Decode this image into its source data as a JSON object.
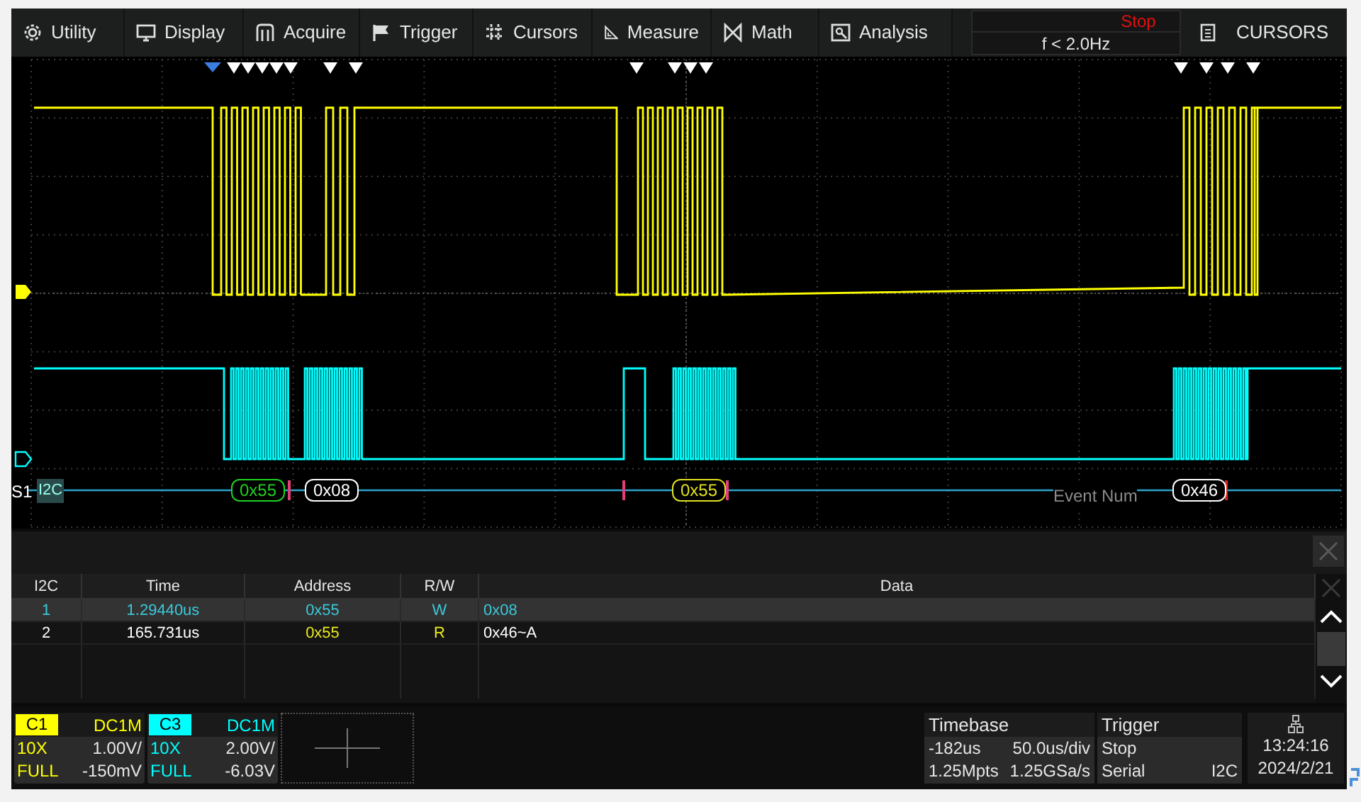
{
  "menu": [
    {
      "kind": "gear",
      "label": "Utility"
    },
    {
      "kind": "monitor",
      "label": "Display"
    },
    {
      "kind": "acquire",
      "label": "Acquire"
    },
    {
      "kind": "flag",
      "label": "Trigger"
    },
    {
      "kind": "hash",
      "label": "Cursors"
    },
    {
      "kind": "ruler",
      "label": "Measure"
    },
    {
      "kind": "bowtie",
      "label": "Math"
    },
    {
      "kind": "picture",
      "label": "Analysis"
    }
  ],
  "run_state": {
    "status": "Stop",
    "trigger_frequency": "f < 2.0Hz"
  },
  "cursors_button": "CURSORS",
  "decode": {
    "bus": "S1",
    "protocol": "I2C",
    "overlay_text": "Event Num",
    "frames": [
      {
        "kind": "address_write",
        "text": "0x55"
      },
      {
        "kind": "data",
        "text": "0x08"
      },
      {
        "kind": "address_read",
        "text": "0x55"
      },
      {
        "kind": "data",
        "text": "0x46"
      }
    ]
  },
  "table": {
    "columns": [
      "I2C",
      "Time",
      "Address",
      "R/W",
      "Data"
    ],
    "rows": [
      {
        "selected": true,
        "cells": [
          "1",
          "1.29440us",
          "0x55",
          "W",
          "0x08"
        ]
      },
      {
        "selected": false,
        "cells": [
          "2",
          "165.731us",
          "0x55",
          "R",
          "0x46~A"
        ]
      }
    ]
  },
  "channels": [
    {
      "name": "C1",
      "color": "#ffff00",
      "coupling": "DC1M",
      "probe": "10X",
      "bandwidth": "FULL",
      "scale": "1.00V/",
      "offset": "-150mV"
    },
    {
      "name": "C3",
      "color": "#00ffff",
      "coupling": "DC1M",
      "probe": "10X",
      "bandwidth": "FULL",
      "scale": "2.00V/",
      "offset": "-6.03V"
    }
  ],
  "timebase": {
    "title": "Timebase",
    "delay": "-182us",
    "scale": "50.0us/div",
    "memory": "1.25Mpts",
    "sample_rate": "1.25GSa/s"
  },
  "trigger": {
    "title": "Trigger",
    "state": "Stop",
    "type": "Serial",
    "source": "I2C"
  },
  "clock": {
    "time": "13:24:16",
    "date": "2024/2/21"
  }
}
